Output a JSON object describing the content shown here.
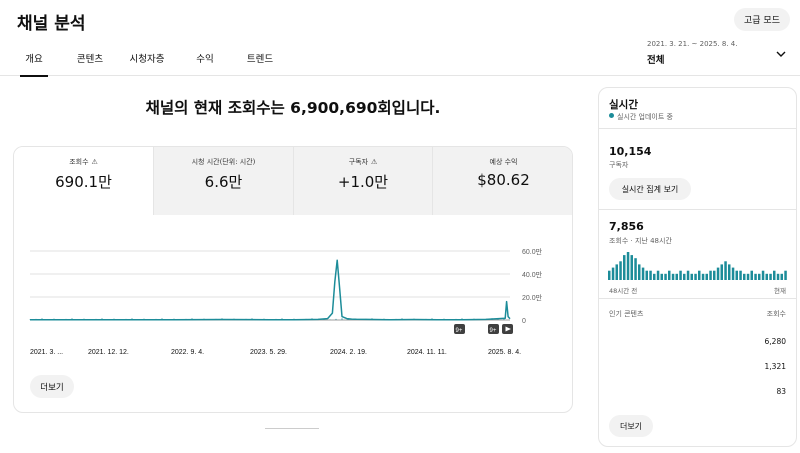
{
  "header": {
    "title": "채널 분석",
    "advanced_button": "고급 모드",
    "tabs": [
      {
        "label": "개요",
        "active": true
      },
      {
        "label": "콘텐츠",
        "active": false
      },
      {
        "label": "시청자층",
        "active": false
      },
      {
        "label": "수익",
        "active": false
      },
      {
        "label": "트렌드",
        "active": false
      }
    ],
    "date_range": "2021. 3. 21. ~ 2025. 8. 4.",
    "date_label": "전체"
  },
  "headline": "채널의 현재 조회수는 6,900,690회입니다.",
  "metrics": [
    {
      "label": "조회수",
      "value": "690.1만",
      "warning": true,
      "active": true
    },
    {
      "label": "시청 시간(단위: 시간)",
      "value": "6.6만",
      "warning": false,
      "active": false
    },
    {
      "label": "구독자",
      "value": "+1.0만",
      "warning": true,
      "active": false
    },
    {
      "label": "예상 수익",
      "value": "$80.62",
      "warning": false,
      "active": false
    }
  ],
  "chart_data": {
    "type": "line",
    "x_ticks": [
      "2021. 3. ...",
      "2021. 12. 12.",
      "2022. 9. 4.",
      "2023. 5. 29.",
      "2024. 2. 19.",
      "2024. 11. 11.",
      "2025. 8. 4."
    ],
    "y_ticks": [
      "60.0만",
      "40.0만",
      "20.0만",
      "0"
    ],
    "ylim": [
      0,
      600000
    ],
    "color": "#1c8c99",
    "series": [
      {
        "x": [
          0,
          0.1,
          0.2,
          0.3,
          0.4,
          0.5,
          0.55,
          0.6,
          0.62,
          0.63,
          0.635,
          0.64,
          0.645,
          0.65,
          0.66,
          0.67,
          0.68,
          0.7,
          0.75,
          0.8,
          0.85,
          0.9,
          0.95,
          0.99,
          0.993,
          0.996,
          1.0
        ],
        "y": [
          2000,
          3000,
          2500,
          3000,
          4000,
          3000,
          3000,
          5000,
          12000,
          60000,
          330000,
          520000,
          280000,
          30000,
          12000,
          8000,
          6000,
          5000,
          3000,
          4000,
          3000,
          3000,
          5000,
          15000,
          160000,
          30000,
          10000
        ]
      }
    ]
  },
  "markers": [
    "9+",
    "9+"
  ],
  "more_button": "더보기",
  "realtime": {
    "title": "실시간",
    "live_status": "실시간 업데이트 중",
    "subscribers_value": "10,154",
    "subscribers_label": "구독자",
    "aggregate_button": "실시간 집계 보기",
    "views_value": "7,856",
    "views_label": "조회수 · 지난 48시간",
    "bars": [
      3,
      4,
      5,
      6,
      8,
      9,
      8,
      7,
      5,
      4,
      3,
      3,
      2,
      3,
      2,
      2,
      3,
      2,
      2,
      3,
      2,
      3,
      2,
      2,
      3,
      2,
      2,
      3,
      3,
      4,
      5,
      6,
      5,
      4,
      3,
      3,
      2,
      2,
      3,
      2,
      2,
      3,
      2,
      2,
      3,
      2,
      2,
      3
    ],
    "axis_left": "48시간 전",
    "axis_right": "현재",
    "content_header": "인기 콘텐츠",
    "views_header": "조회수",
    "content_rows": [
      "6,280",
      "1,321",
      "83"
    ],
    "more_button": "더보기"
  }
}
